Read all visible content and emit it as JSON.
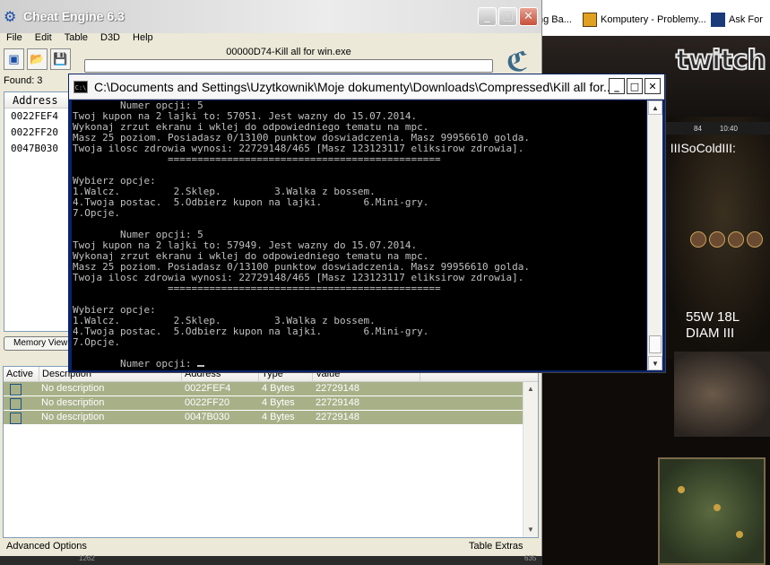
{
  "browser_tabs": [
    {
      "label": "ng Ba...",
      "icon": "flag-favicon"
    },
    {
      "label": "Komputery - Problemy...",
      "icon": "forum-favicon"
    },
    {
      "label": "Ask For",
      "icon": "ask-favicon"
    }
  ],
  "stream": {
    "logo": "twitch",
    "hud_values": [
      "84",
      "10:40"
    ],
    "player_name": ", IIISoColdIII:",
    "stats_line1": "55W 18L",
    "stats_line2": "DIAM III",
    "bottom_numbers": [
      "1262",
      "635"
    ]
  },
  "cheat_engine": {
    "title": "Cheat Engine 6.3",
    "menu": [
      "File",
      "Edit",
      "Table",
      "D3D",
      "Help"
    ],
    "toolbar": [
      "open-process-icon",
      "open-file-icon",
      "save-icon"
    ],
    "process_label": "00000D74-Kill all for win.exe",
    "found_label": "Found: 3",
    "address_header": "Address",
    "addresses": [
      "0022FEF4",
      "0022FF20",
      "0047B030"
    ],
    "memory_view_label": "Memory View",
    "table_headers": [
      "Active",
      "Description",
      "Address",
      "Type",
      "Value"
    ],
    "table_rows": [
      {
        "description": "No description",
        "address": "0022FEF4",
        "type": "4 Bytes",
        "value": "22729148"
      },
      {
        "description": "No description",
        "address": "0022FF20",
        "type": "4 Bytes",
        "value": "22729148"
      },
      {
        "description": "No description",
        "address": "0047B030",
        "type": "4 Bytes",
        "value": "22729148"
      }
    ],
    "advanced_options": "Advanced Options",
    "table_extras": "Table Extras"
  },
  "console": {
    "title": "C:\\Documents and Settings\\Uzytkownik\\Moje dokumenty\\Downloads\\Compressed\\Kill all for...",
    "lines": [
      "        Numer opcji: 5",
      "Twoj kupon na 2 lajki to: 57051. Jest wazny do 15.07.2014.",
      "Wykonaj zrzut ekranu i wklej do odpowiedniego tematu na mpc.",
      "Masz 25 poziom. Posiadasz 0/13100 punktow doswiadczenia. Masz 99956610 golda.",
      "Twoja ilosc zdrowia wynosi: 22729148/465 [Masz 123123117 eliksirow zdrowia].",
      "                ==============================================",
      "",
      "Wybierz opcje:",
      "1.Walcz.         2.Sklep.         3.Walka z bossem.",
      "4.Twoja postac.  5.Odbierz kupon na lajki.       6.Mini-gry.",
      "7.Opcje.",
      "",
      "        Numer opcji: 5",
      "Twoj kupon na 2 lajki to: 57949. Jest wazny do 15.07.2014.",
      "Wykonaj zrzut ekranu i wklej do odpowiedniego tematu na mpc.",
      "Masz 25 poziom. Posiadasz 0/13100 punktow doswiadczenia. Masz 99956610 golda.",
      "Twoja ilosc zdrowia wynosi: 22729148/465 [Masz 123123117 eliksirow zdrowia].",
      "                ==============================================",
      "",
      "Wybierz opcje:",
      "1.Walcz.         2.Sklep.         3.Walka z bossem.",
      "4.Twoja postac.  5.Odbierz kupon na lajki.       6.Mini-gry.",
      "7.Opcje.",
      "",
      "        Numer opcji: "
    ]
  }
}
